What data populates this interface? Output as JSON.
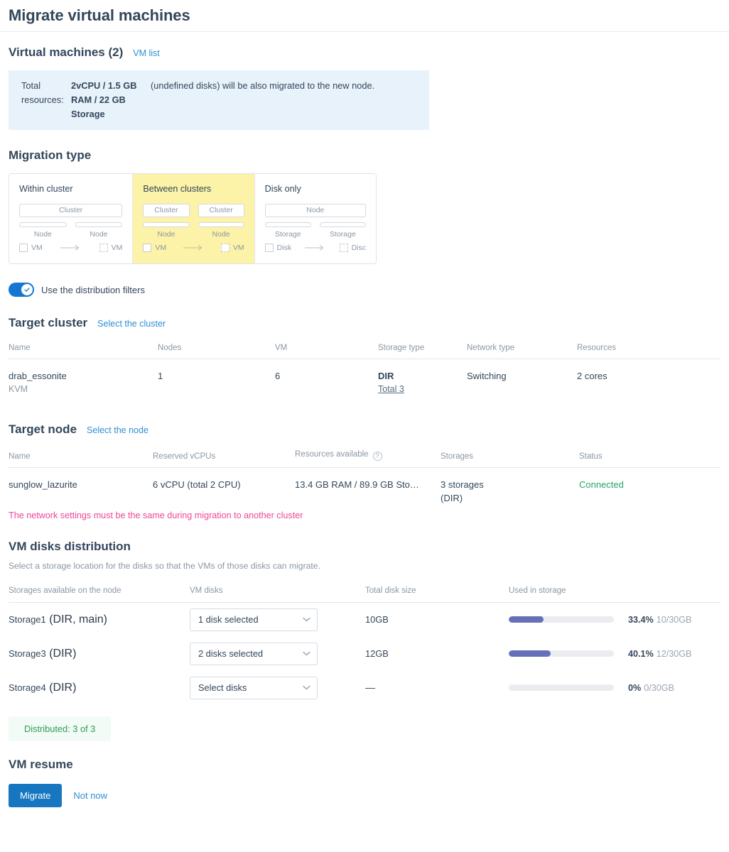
{
  "header": {
    "title": "Migrate virtual machines"
  },
  "vm_section": {
    "title": "Virtual machines (2)",
    "list_link": "VM list",
    "banner": {
      "label": "Total resources:",
      "value": "2vCPU / 1.5 GB RAM / 22 GB Storage",
      "note": "(undefined disks) will be also migrated to the new node."
    }
  },
  "migration_type": {
    "title": "Migration type",
    "cards": [
      {
        "title": "Within cluster",
        "selected": false,
        "top_box_mode": "single",
        "top_labels": [
          "Cluster"
        ],
        "mid_labels": [
          "Node",
          "Node"
        ],
        "unit_left": "VM",
        "unit_right": "VM"
      },
      {
        "title": "Between clusters",
        "selected": true,
        "top_box_mode": "double",
        "top_labels": [
          "Cluster",
          "Cluster"
        ],
        "mid_labels": [
          "Node",
          "Node"
        ],
        "unit_left": "VM",
        "unit_right": "VM"
      },
      {
        "title": "Disk only",
        "selected": false,
        "top_box_mode": "single",
        "top_labels": [
          "Node"
        ],
        "mid_labels": [
          "Storage",
          "Storage"
        ],
        "unit_left": "Disk",
        "unit_right": "Disc"
      }
    ]
  },
  "distribution_filters": {
    "label": "Use the distribution filters",
    "enabled": true
  },
  "target_cluster": {
    "title": "Target cluster",
    "select_link": "Select the cluster",
    "columns": [
      "Name",
      "Nodes",
      "VM",
      "Storage type",
      "Network type",
      "Resources"
    ],
    "row": {
      "name": "drab_essonite",
      "name_sub": "KVM",
      "nodes": "1",
      "vm": "6",
      "storage_type": "DIR",
      "storage_total": "Total 3",
      "network_type": "Switching",
      "resources": "2 cores"
    }
  },
  "target_node": {
    "title": "Target node",
    "select_link": "Select the node",
    "columns": [
      "Name",
      "Reserved vCPUs",
      "Resources available",
      "Storages",
      "Status"
    ],
    "help_icon": "question-icon",
    "row": {
      "name": "sunglow_lazurite",
      "reserved_vcpus": "6 vCPU (total 2 CPU)",
      "resources_available": "13.4 GB RAM / 89.9 GB Sto…",
      "storages": "3 storages",
      "storages_sub": "(DIR)",
      "status": "Connected"
    },
    "warning": "The network settings must be the same during migration to another cluster"
  },
  "vm_disks": {
    "title": "VM disks distribution",
    "description": "Select a storage location for the disks so that the VMs of those disks can migrate.",
    "columns": [
      "Storages available on the node",
      "VM disks",
      "Total disk size",
      "Used in storage"
    ],
    "rows": [
      {
        "storage_name": "Storage1",
        "storage_type": "(DIR, main)",
        "select_value": "1 disk selected",
        "total_size": "10GB",
        "percent_label": "33.4%",
        "absolute_label": "10/30GB",
        "percent_value": 33.4
      },
      {
        "storage_name": "Storage3",
        "storage_type": "(DIR)",
        "select_value": "2 disks selected",
        "total_size": "12GB",
        "percent_label": "40.1%",
        "absolute_label": "12/30GB",
        "percent_value": 40.1
      },
      {
        "storage_name": "Storage4",
        "storage_type": "(DIR)",
        "select_value": "Select disks",
        "total_size": "—",
        "percent_label": "0%",
        "absolute_label": "0/30GB",
        "percent_value": 0
      }
    ],
    "distributed_badge": "Distributed: 3 of 3"
  },
  "vm_resume": {
    "title": "VM resume",
    "migrate_label": "Migrate",
    "not_now_label": "Not now"
  },
  "colors": {
    "accent_blue": "#1677c0",
    "link_blue": "#2e8fd6",
    "selected_card": "#fcf3a8",
    "banner_bg": "#e8f2fb",
    "bar_fill": "#6670b8",
    "warning_pink": "#ec4899",
    "status_green": "#27a567",
    "badge_green": "#2f9b57"
  }
}
